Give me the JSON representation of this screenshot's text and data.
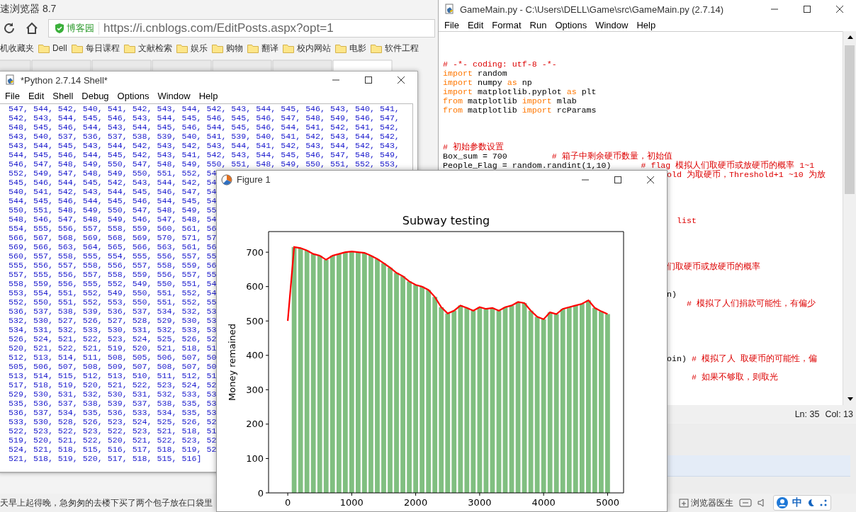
{
  "browser": {
    "title": "速浏览器 8.7",
    "site_badge": "博客园",
    "url": "https://i.cnblogs.com/EditPosts.aspx?opt=1",
    "bookmarks": [
      {
        "kind": "plain",
        "label": "机收藏夹"
      },
      {
        "kind": "folder",
        "label": "Dell"
      },
      {
        "kind": "folder",
        "label": "每日课程"
      },
      {
        "kind": "folder",
        "label": "文献检索"
      },
      {
        "kind": "folder",
        "label": "娱乐"
      },
      {
        "kind": "folder",
        "label": "购物"
      },
      {
        "kind": "folder",
        "label": "翻译"
      },
      {
        "kind": "folder",
        "label": "校内网站"
      },
      {
        "kind": "folder",
        "label": "电影"
      },
      {
        "kind": "folder",
        "label": "软件工程"
      }
    ],
    "status_text": "天早上起得晚，急匆匆的去楼下买了两个包子放在口袋里",
    "doctor": "浏览器医生",
    "input_mode": "中"
  },
  "shell": {
    "title": "*Python 2.7.14 Shell*",
    "menu": [
      "File",
      "Edit",
      "Shell",
      "Debug",
      "Options",
      "Window",
      "Help"
    ],
    "lines": [
      "547, 544, 542, 540, 541, 542, 543, 544, 542, 543, 544, 545, 546, 543, 540, 541,",
      "542, 543, 544, 545, 546, 543, 544, 545, 546, 545, 546, 547, 548, 549, 546, 547,",
      "548, 545, 546, 544, 543, 544, 545, 546, 544, 545, 546, 544, 541, 542, 541, 542,",
      "543, 540, 537, 536, 537, 538, 539, 540, 541, 539, 540, 541, 542, 543, 544, 542,",
      "543, 544, 545, 543, 544, 542, 543, 542, 543, 544, 541, 542, 543, 544, 542, 543,",
      "544, 545, 546, 544, 545, 542, 543, 541, 542, 543, 544, 545, 546, 547, 548, 549,",
      "546, 547, 548, 549, 550, 547, 548, 549, 550, 551, 548, 549, 550, 551, 552, 553,",
      "552, 549, 547, 548, 549, 550, 551, 552, 54",
      "545, 546, 544, 545, 542, 543, 544, 542, 54",
      "540, 541, 542, 543, 544, 545, 546, 547, 54",
      "544, 545, 546, 544, 545, 546, 544, 545, 54",
      "550, 551, 548, 549, 550, 547, 548, 549, 55",
      "548, 546, 547, 548, 549, 546, 547, 548, 54",
      "554, 555, 556, 557, 558, 559, 560, 561, 56",
      "566, 567, 568, 569, 568, 569, 570, 571, 57",
      "569, 566, 563, 564, 565, 566, 563, 561, 56",
      "560, 557, 558, 555, 554, 555, 556, 557, 55",
      "555, 556, 557, 558, 556, 557, 558, 559, 56",
      "557, 555, 556, 557, 558, 559, 556, 557, 55",
      "558, 559, 556, 555, 552, 549, 550, 551, 54",
      "553, 554, 551, 552, 549, 550, 551, 552, 54",
      "552, 550, 551, 552, 553, 550, 551, 552, 55",
      "536, 537, 538, 539, 536, 537, 534, 532, 53",
      "532, 530, 527, 526, 527, 528, 529, 530, 53",
      "534, 531, 532, 533, 530, 531, 532, 533, 53",
      "526, 524, 521, 522, 523, 524, 525, 526, 52",
      "520, 521, 522, 521, 519, 520, 521, 518, 51",
      "512, 513, 514, 511, 508, 505, 506, 507, 50",
      "505, 506, 507, 508, 509, 507, 508, 507, 50",
      "513, 514, 515, 512, 513, 510, 511, 512, 51",
      "517, 518, 519, 520, 521, 522, 523, 524, 52",
      "529, 530, 531, 532, 530, 531, 532, 533, 53",
      "535, 536, 537, 538, 539, 537, 538, 535, 53",
      "536, 537, 534, 535, 536, 533, 534, 535, 53",
      "533, 530, 528, 526, 523, 524, 525, 526, 52",
      "522, 523, 522, 523, 522, 523, 521, 518, 51",
      "519, 520, 521, 522, 520, 521, 522, 523, 52",
      "524, 521, 518, 515, 516, 517, 518, 519, 52",
      "521, 518, 519, 520, 517, 518, 515, 516]"
    ]
  },
  "editor": {
    "title": "GameMain.py - C:\\Users\\DELL\\Game\\src\\GameMain.py (2.7.14)",
    "menu": [
      "File",
      "Edit",
      "Format",
      "Run",
      "Options",
      "Window",
      "Help"
    ],
    "lines": [
      {
        "kind": "blank"
      },
      {
        "kind": "blank"
      },
      {
        "kind": "blank"
      },
      {
        "kind": "code",
        "segments": [
          {
            "kind": "comment",
            "text": "# -*- coding: utf-8 -*-"
          }
        ]
      },
      {
        "kind": "code",
        "segments": [
          {
            "kind": "keyword",
            "text": "import"
          },
          {
            "kind": "plain",
            "text": " random"
          }
        ]
      },
      {
        "kind": "code",
        "segments": [
          {
            "kind": "keyword",
            "text": "import"
          },
          {
            "kind": "plain",
            "text": " numpy "
          },
          {
            "kind": "keyword",
            "text": "as"
          },
          {
            "kind": "plain",
            "text": " np"
          }
        ]
      },
      {
        "kind": "code",
        "segments": [
          {
            "kind": "keyword",
            "text": "import"
          },
          {
            "kind": "plain",
            "text": " matplotlib.pyplot "
          },
          {
            "kind": "keyword",
            "text": "as"
          },
          {
            "kind": "plain",
            "text": " plt"
          }
        ]
      },
      {
        "kind": "code",
        "segments": [
          {
            "kind": "keyword",
            "text": "from"
          },
          {
            "kind": "plain",
            "text": " matplotlib "
          },
          {
            "kind": "keyword",
            "text": "import"
          },
          {
            "kind": "plain",
            "text": " mlab"
          }
        ]
      },
      {
        "kind": "code",
        "segments": [
          {
            "kind": "keyword",
            "text": "from"
          },
          {
            "kind": "plain",
            "text": " matplotlib "
          },
          {
            "kind": "keyword",
            "text": "import"
          },
          {
            "kind": "plain",
            "text": " rcParams"
          }
        ]
      },
      {
        "kind": "blank"
      },
      {
        "kind": "blank"
      },
      {
        "kind": "blank"
      },
      {
        "kind": "code",
        "segments": [
          {
            "kind": "comment",
            "text": "# 初始参数设置"
          }
        ]
      },
      {
        "kind": "code",
        "segments": [
          {
            "kind": "plain",
            "text": "Box_sum = 700         "
          },
          {
            "kind": "comment",
            "text": "# 箱子中剩余硬币数量，初始值"
          }
        ]
      },
      {
        "kind": "code",
        "segments": [
          {
            "kind": "plain",
            "text": "People_Flag = random.randint(1,10)      "
          },
          {
            "kind": "comment",
            "text": "# flag 模拟人们取硬币或放硬币的概率 1~1"
          }
        ]
      },
      {
        "kind": "tail",
        "segments": [
          {
            "kind": "comment",
            "text": "old 为取硬币，Threshold+1 ~10 为放"
          }
        ]
      },
      {
        "kind": "blank"
      },
      {
        "kind": "blank"
      },
      {
        "kind": "blank"
      },
      {
        "kind": "blank"
      },
      {
        "kind": "tail",
        "segments": [
          {
            "kind": "comment",
            "text": "  list"
          }
        ]
      },
      {
        "kind": "blank"
      },
      {
        "kind": "blank"
      },
      {
        "kind": "blank"
      },
      {
        "kind": "blank"
      },
      {
        "kind": "tail",
        "segments": [
          {
            "kind": "comment",
            "text": "们取硬币或放硬币的概率"
          }
        ]
      },
      {
        "kind": "blank"
      },
      {
        "kind": "blank"
      },
      {
        "kind": "tail",
        "segments": [
          {
            "kind": "plain",
            "text": "n)"
          }
        ]
      },
      {
        "kind": "tail",
        "segments": [
          {
            "kind": "comment",
            "text": "    # 模拟了人们捐款可能性，有偏少"
          }
        ]
      },
      {
        "kind": "blank"
      },
      {
        "kind": "blank"
      },
      {
        "kind": "blank"
      },
      {
        "kind": "blank"
      },
      {
        "kind": "blank"
      },
      {
        "kind": "tail",
        "segments": [
          {
            "kind": "plain",
            "text": "oin) "
          },
          {
            "kind": "comment",
            "text": "# 模拟了人 取硬币的可能性，偏"
          }
        ]
      },
      {
        "kind": "blank"
      },
      {
        "kind": "tail",
        "segments": [
          {
            "kind": "comment",
            "text": "     # 如果不够取，则取光"
          }
        ]
      }
    ],
    "status": {
      "line": "Ln: 35",
      "col": "Col: 13"
    }
  },
  "figure": {
    "title": "Figure 1",
    "chart_data": {
      "type": "bar",
      "title": "Subway testing",
      "ylabel": "Money remained",
      "x": [
        0,
        100,
        200,
        300,
        400,
        500,
        600,
        700,
        800,
        900,
        1000,
        1100,
        1200,
        1300,
        1400,
        1500,
        1600,
        1700,
        1800,
        1900,
        2000,
        2100,
        2200,
        2300,
        2400,
        2500,
        2600,
        2700,
        2800,
        2900,
        3000,
        3100,
        3200,
        3300,
        3400,
        3500,
        3600,
        3700,
        3800,
        3900,
        4000,
        4100,
        4200,
        4300,
        4400,
        4500,
        4600,
        4700,
        4800,
        4900,
        5000
      ],
      "series": [
        {
          "color": "#80bf80",
          "values": [
            null,
            715,
            712,
            705,
            695,
            690,
            678,
            690,
            695,
            700,
            702,
            700,
            698,
            690,
            680,
            668,
            655,
            640,
            630,
            615,
            605,
            600,
            590,
            570,
            540,
            522,
            530,
            545,
            538,
            530,
            540,
            535,
            538,
            530,
            540,
            545,
            555,
            552,
            530,
            512,
            505,
            525,
            520,
            535,
            540,
            545,
            550,
            560,
            538,
            528,
            520
          ]
        },
        {
          "type": "line",
          "color": "#ff0000",
          "values": [
            500,
            715,
            712,
            705,
            695,
            690,
            678,
            690,
            695,
            700,
            702,
            700,
            698,
            690,
            680,
            668,
            655,
            640,
            630,
            615,
            605,
            600,
            590,
            570,
            540,
            522,
            530,
            545,
            538,
            530,
            540,
            535,
            538,
            530,
            540,
            545,
            555,
            552,
            530,
            512,
            505,
            525,
            520,
            535,
            540,
            545,
            550,
            560,
            538,
            528,
            520
          ]
        }
      ],
      "ylim": [
        0,
        760
      ],
      "xticks": [
        0,
        1000,
        2000,
        3000,
        4000,
        5000
      ],
      "xlim": [
        -300,
        5250
      ],
      "yticks": [
        0,
        100,
        200,
        300,
        400,
        500,
        600,
        700
      ]
    }
  }
}
